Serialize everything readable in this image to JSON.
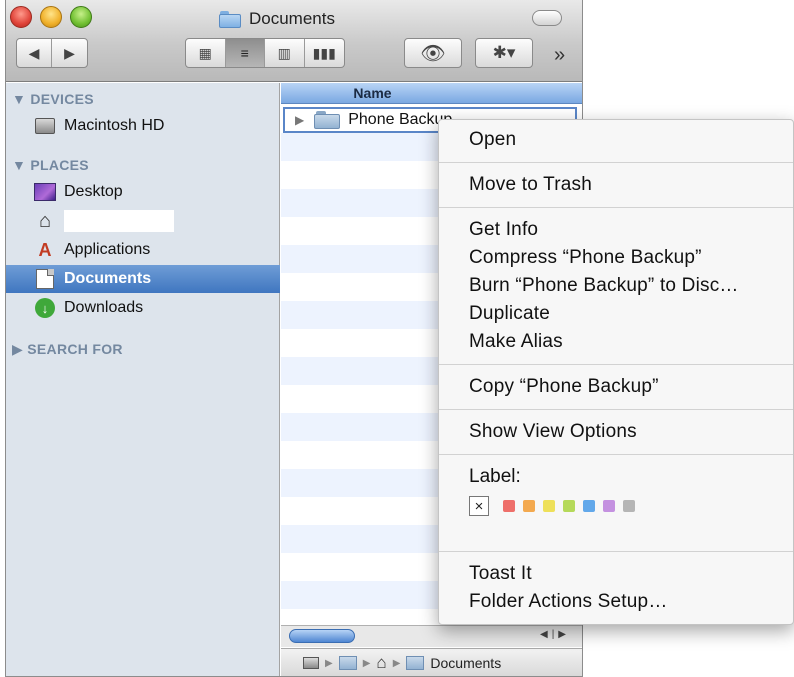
{
  "window": {
    "title": "Documents",
    "more_label": "»"
  },
  "toolbar": {
    "back_label": "◀",
    "forward_label": "▶",
    "view_icons": "▦",
    "view_list": "≡",
    "view_columns": "▥",
    "view_coverflow": "▮▮▮",
    "quicklook_label": "👁",
    "action_label": "✱▾"
  },
  "sidebar": {
    "devices_header": "▼ DEVICES",
    "places_header": "▼ PLACES",
    "search_header": "▶ SEARCH FOR",
    "devices": [
      {
        "label": "Macintosh HD",
        "icon": "hard-drive-icon"
      }
    ],
    "places": [
      {
        "label": "Desktop",
        "icon": "desktop-icon"
      },
      {
        "label": "",
        "icon": "home-icon"
      },
      {
        "label": "Applications",
        "icon": "applications-icon"
      },
      {
        "label": "Documents",
        "icon": "documents-icon"
      },
      {
        "label": "Downloads",
        "icon": "downloads-icon"
      }
    ]
  },
  "list": {
    "column_name": "Name",
    "files": [
      {
        "name": "Phone Backup",
        "kind": "folder"
      }
    ]
  },
  "pathbar": {
    "current": "Documents"
  },
  "context_menu": {
    "groups": [
      [
        "Open"
      ],
      [
        "Move to Trash"
      ],
      [
        "Get Info",
        "Compress “Phone Backup”",
        "Burn “Phone Backup” to Disc…",
        "Duplicate",
        "Make Alias"
      ],
      [
        "Copy “Phone Backup”"
      ],
      [
        "Show View Options"
      ]
    ],
    "label_title": "Label:",
    "label_none": "×",
    "label_colors": [
      "#ee6f6a",
      "#f3a94f",
      "#eee05a",
      "#b5d95a",
      "#62a8ea",
      "#c491e0",
      "#b5b5b5"
    ],
    "footer_items": [
      "Toast It",
      "Folder Actions Setup…"
    ]
  }
}
